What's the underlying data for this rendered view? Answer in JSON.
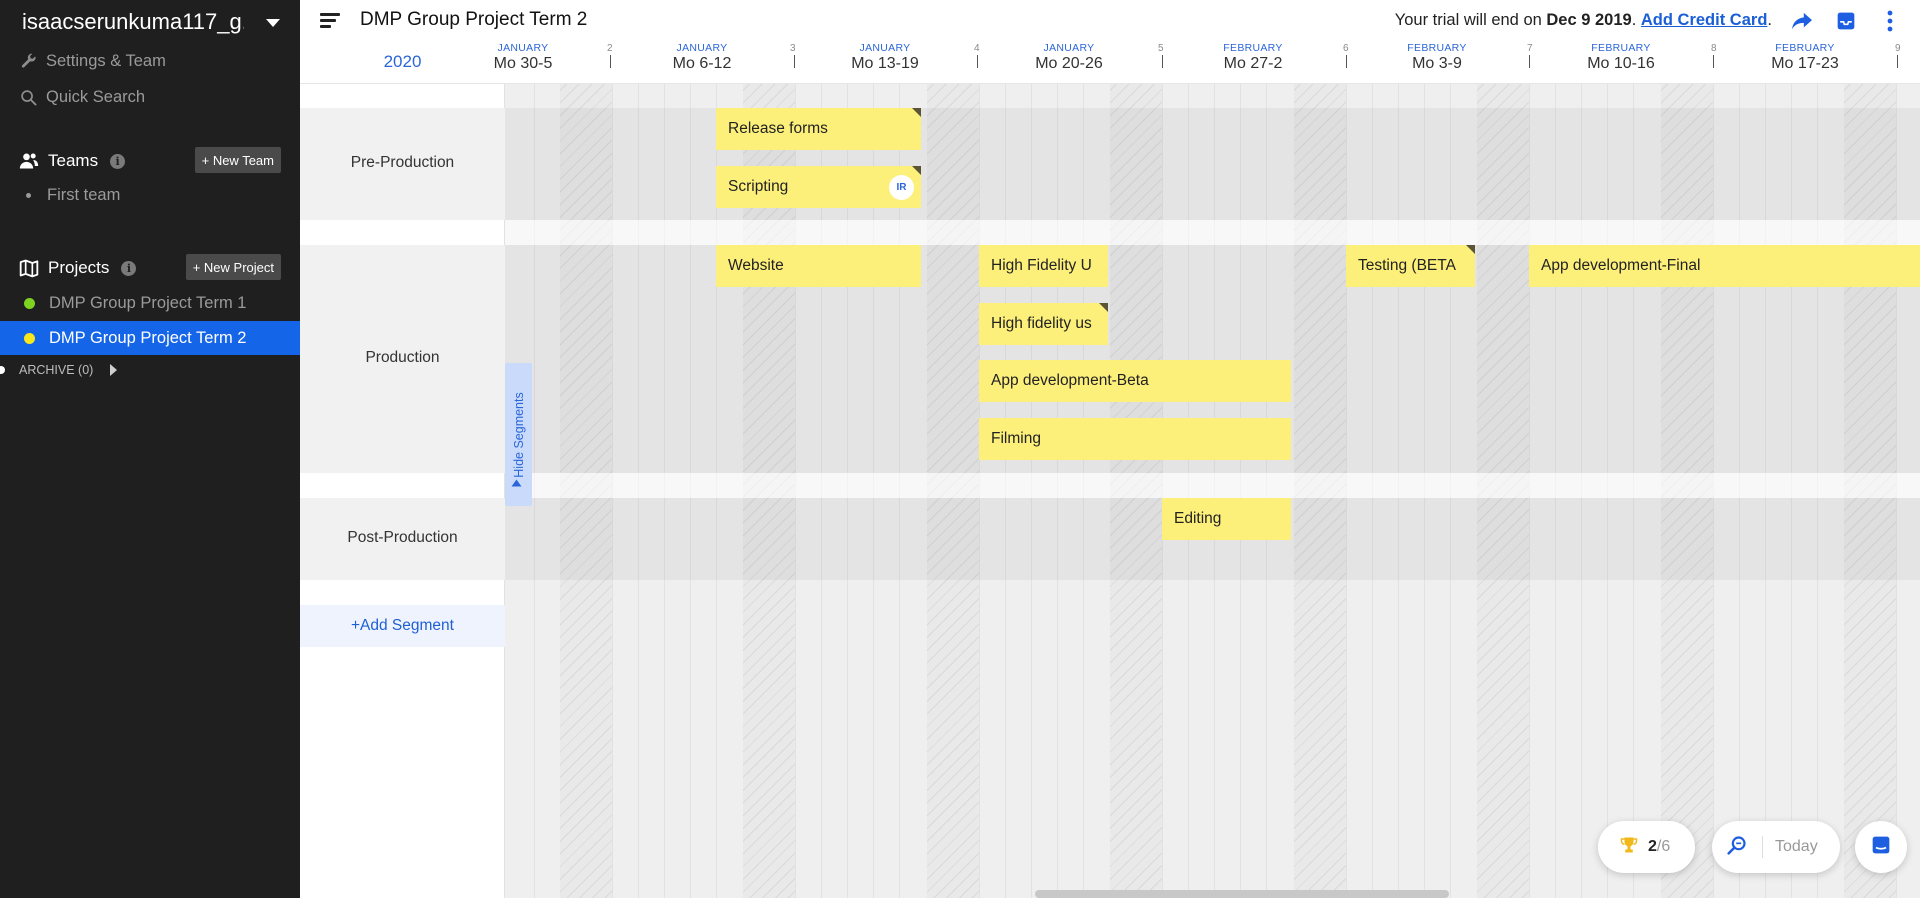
{
  "sidebar": {
    "account_name": "isaacserunkuma117_g...",
    "settings_label": "Settings & Team",
    "search_label": "Quick Search",
    "teams_heading": "Teams",
    "new_team_label": "+ New Team",
    "teams": [
      {
        "name": "First team"
      }
    ],
    "projects_heading": "Projects",
    "new_project_label": "+ New Project",
    "projects": [
      {
        "name": "DMP Group Project Term 1",
        "color": "#7ed321",
        "active": false
      },
      {
        "name": "DMP Group Project Term 2",
        "color": "#f8e71c",
        "active": true
      }
    ],
    "archive_label": "ARCHIVE (0)"
  },
  "topbar": {
    "project_title": "DMP Group Project Term 2",
    "trial_prefix": "Your trial will end on",
    "trial_date": "Dec 9 2019",
    "add_credit_card": "Add Credit Card",
    "share_icon": "share-icon",
    "inbox_icon": "inbox-icon",
    "more_icon": "more-vertical-icon"
  },
  "timeline": {
    "year": "2020",
    "weeks": [
      {
        "month": "JANUARY",
        "range": "Mo 30-5",
        "num": ""
      },
      {
        "month": "JANUARY",
        "range": "Mo 6-12",
        "num": "2"
      },
      {
        "month": "JANUARY",
        "range": "Mo 13-19",
        "num": "3"
      },
      {
        "month": "JANUARY",
        "range": "Mo 20-26",
        "num": "4"
      },
      {
        "month": "FEBRUARY",
        "range": "Mo 27-2",
        "num": "5"
      },
      {
        "month": "FEBRUARY",
        "range": "Mo 3-9",
        "num": "6"
      },
      {
        "month": "FEBRUARY",
        "range": "Mo 10-16",
        "num": "7"
      },
      {
        "month": "FEBRUARY",
        "range": "Mo 17-23",
        "num": "8"
      },
      {
        "month": "",
        "range": "",
        "num": "9"
      }
    ]
  },
  "segments": [
    {
      "name": "Pre-Production"
    },
    {
      "name": "Production"
    },
    {
      "name": "Post-Production"
    }
  ],
  "add_segment_label": "+Add Segment",
  "hide_segments_label": "Hide Segments",
  "tasks": [
    {
      "name": "Release forms",
      "segment": "Pre-Production",
      "flagged": true
    },
    {
      "name": "Scripting",
      "segment": "Pre-Production",
      "flagged": true,
      "assignee": "IR"
    },
    {
      "name": "Website",
      "segment": "Production",
      "flagged": false
    },
    {
      "name": "High Fidelity U",
      "segment": "Production",
      "flagged": false
    },
    {
      "name": "Testing (BETA",
      "segment": "Production",
      "flagged": true
    },
    {
      "name": "App development-Final",
      "segment": "Production",
      "flagged": false
    },
    {
      "name": "High fidelity us",
      "segment": "Production",
      "flagged": true
    },
    {
      "name": "App development-Beta",
      "segment": "Production",
      "flagged": false
    },
    {
      "name": "Filming",
      "segment": "Production",
      "flagged": false
    },
    {
      "name": "Editing",
      "segment": "Post-Production",
      "flagged": false
    }
  ],
  "footer": {
    "achievements_done": "2",
    "achievements_total": "/6",
    "today_label": "Today",
    "zoom_icon": "zoom-icon",
    "trophy_icon": "trophy-icon",
    "chat_icon": "chat-icon"
  },
  "colors": {
    "sidebar_bg": "#1f1f1f",
    "accent": "#1565e8",
    "task_yellow": "#fdf07a"
  }
}
